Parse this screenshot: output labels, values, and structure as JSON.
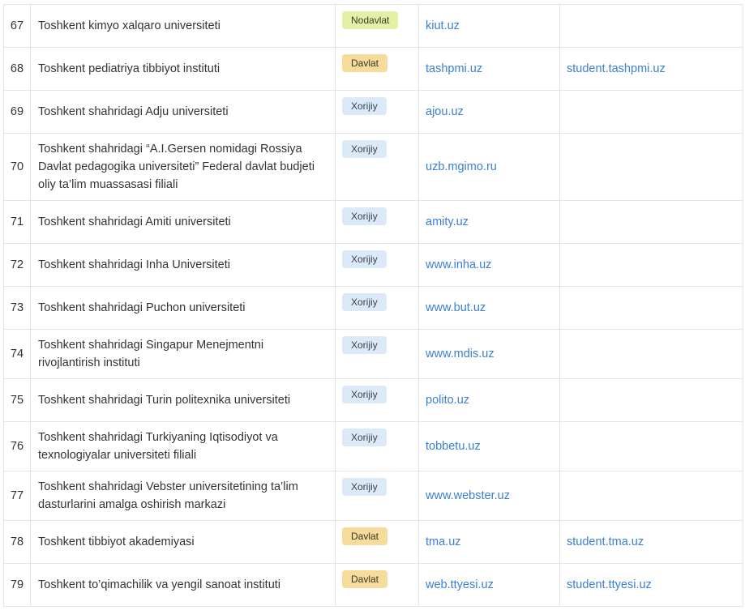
{
  "rows": [
    {
      "num": "67",
      "name_lines": [
        "Toshkent kimyo xalqaro universiteti"
      ],
      "type": "Nodavlat",
      "site": "kiut.uz",
      "portal": "",
      "h": 53
    },
    {
      "num": "68",
      "name_lines": [
        "Toshkent pediatriya tibbiyot instituti"
      ],
      "type": "Davlat",
      "site": "tashpmi.uz",
      "portal": "student.tashpmi.uz",
      "h": 53
    },
    {
      "num": "69",
      "name_lines": [
        "Toshkent shahridagi Adju universiteti"
      ],
      "type": "Xorijiy",
      "site": "ajou.uz",
      "portal": "",
      "h": 53
    },
    {
      "num": "70",
      "name_lines": [
        "Toshkent shahridagi “A.I.Gersen nomidagi Rossiya",
        "Davlat pedagogika universiteti” Federal davlat budjeti",
        "oliy ta’lim muassasasi filiali"
      ],
      "type": "Xorijiy",
      "site": "uzb.mgimo.ru",
      "portal": "",
      "h": 83
    },
    {
      "num": "71",
      "name_lines": [
        "Toshkent shahridagi Amiti universiteti"
      ],
      "type": "Xorijiy",
      "site": "amity.uz",
      "portal": "",
      "h": 53
    },
    {
      "num": "72",
      "name_lines": [
        "Toshkent shahridagi Inha Universiteti"
      ],
      "type": "Xorijiy",
      "site": "www.inha.uz",
      "portal": "",
      "h": 53
    },
    {
      "num": "73",
      "name_lines": [
        "Toshkent shahridagi Puchon universiteti"
      ],
      "type": "Xorijiy",
      "site": "www.but.uz",
      "portal": "",
      "h": 53
    },
    {
      "num": "74",
      "name_lines": [
        "Toshkent shahridagi Singapur Menejmentni",
        "rivojlantirish instituti"
      ],
      "type": "Xorijiy",
      "site": "www.mdis.uz",
      "portal": "",
      "h": 61
    },
    {
      "num": "75",
      "name_lines": [
        "Toshkent shahridagi Turin politexnika universiteti"
      ],
      "type": "Xorijiy",
      "site": "polito.uz",
      "portal": "",
      "h": 53
    },
    {
      "num": "76",
      "name_lines": [
        "Toshkent shahridagi Turkiyaning Iqtisodiyot va",
        "texnologiyalar universiteti filiali"
      ],
      "type": "Xorijiy",
      "site": "tobbetu.uz",
      "portal": "",
      "h": 61
    },
    {
      "num": "77",
      "name_lines": [
        "Toshkent shahridagi Vebster universitetining ta’lim",
        "dasturlarini amalga oshirish markazi"
      ],
      "type": "Xorijiy",
      "site": "www.webster.uz",
      "portal": "",
      "h": 61
    },
    {
      "num": "78",
      "name_lines": [
        "Toshkent tibbiyot akademiyasi"
      ],
      "type": "Davlat",
      "site": "tma.uz",
      "portal": "student.tma.uz",
      "h": 53
    },
    {
      "num": "79",
      "name_lines": [
        "Toshkent to’qimachilik va yengil sanoat instituti"
      ],
      "type": "Davlat",
      "site": "web.ttyesi.uz",
      "portal": "student.ttyesi.uz",
      "h": 53
    }
  ],
  "colors": {
    "nodavlat": "#e4f0a6",
    "davlat": "#f5dc9a",
    "xorijiy": "#dbe9f8",
    "link": "#3b7fd4",
    "border": "#e5e5e5"
  }
}
